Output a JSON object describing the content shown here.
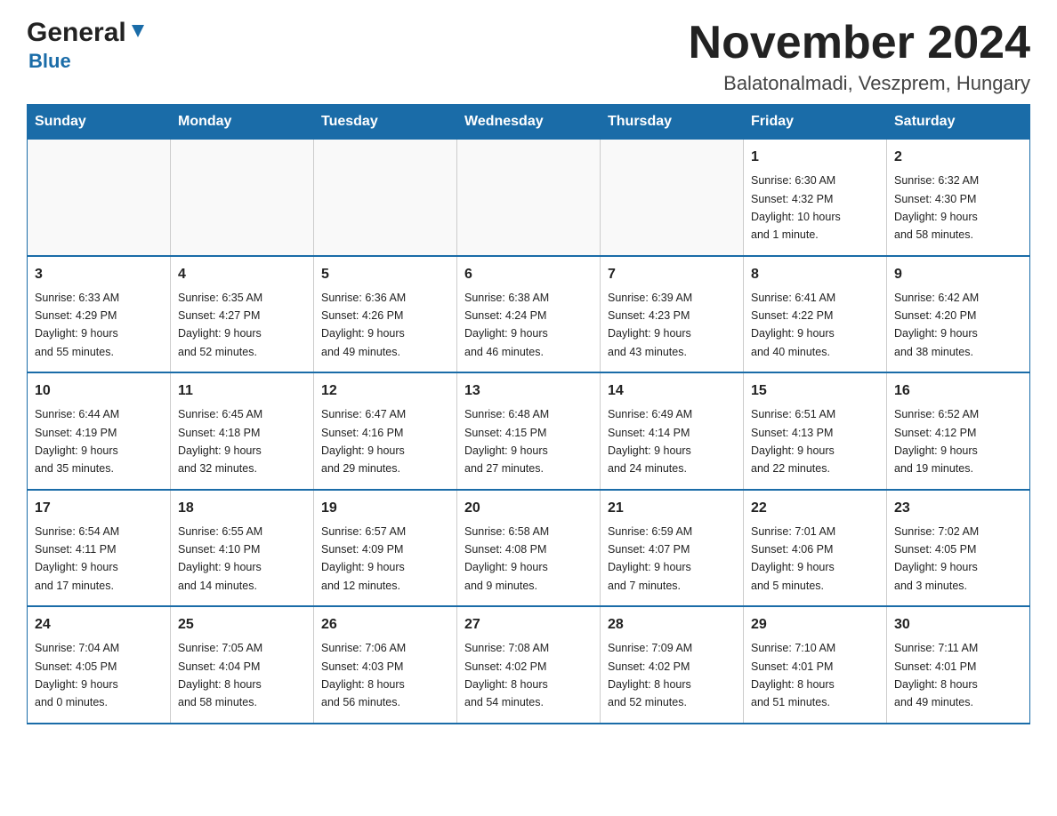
{
  "header": {
    "logo_general": "General",
    "logo_blue": "Blue",
    "title": "November 2024",
    "subtitle": "Balatonalmadi, Veszprem, Hungary"
  },
  "days_of_week": [
    "Sunday",
    "Monday",
    "Tuesday",
    "Wednesday",
    "Thursday",
    "Friday",
    "Saturday"
  ],
  "weeks": [
    [
      {
        "day": "",
        "info": ""
      },
      {
        "day": "",
        "info": ""
      },
      {
        "day": "",
        "info": ""
      },
      {
        "day": "",
        "info": ""
      },
      {
        "day": "",
        "info": ""
      },
      {
        "day": "1",
        "info": "Sunrise: 6:30 AM\nSunset: 4:32 PM\nDaylight: 10 hours\nand 1 minute."
      },
      {
        "day": "2",
        "info": "Sunrise: 6:32 AM\nSunset: 4:30 PM\nDaylight: 9 hours\nand 58 minutes."
      }
    ],
    [
      {
        "day": "3",
        "info": "Sunrise: 6:33 AM\nSunset: 4:29 PM\nDaylight: 9 hours\nand 55 minutes."
      },
      {
        "day": "4",
        "info": "Sunrise: 6:35 AM\nSunset: 4:27 PM\nDaylight: 9 hours\nand 52 minutes."
      },
      {
        "day": "5",
        "info": "Sunrise: 6:36 AM\nSunset: 4:26 PM\nDaylight: 9 hours\nand 49 minutes."
      },
      {
        "day": "6",
        "info": "Sunrise: 6:38 AM\nSunset: 4:24 PM\nDaylight: 9 hours\nand 46 minutes."
      },
      {
        "day": "7",
        "info": "Sunrise: 6:39 AM\nSunset: 4:23 PM\nDaylight: 9 hours\nand 43 minutes."
      },
      {
        "day": "8",
        "info": "Sunrise: 6:41 AM\nSunset: 4:22 PM\nDaylight: 9 hours\nand 40 minutes."
      },
      {
        "day": "9",
        "info": "Sunrise: 6:42 AM\nSunset: 4:20 PM\nDaylight: 9 hours\nand 38 minutes."
      }
    ],
    [
      {
        "day": "10",
        "info": "Sunrise: 6:44 AM\nSunset: 4:19 PM\nDaylight: 9 hours\nand 35 minutes."
      },
      {
        "day": "11",
        "info": "Sunrise: 6:45 AM\nSunset: 4:18 PM\nDaylight: 9 hours\nand 32 minutes."
      },
      {
        "day": "12",
        "info": "Sunrise: 6:47 AM\nSunset: 4:16 PM\nDaylight: 9 hours\nand 29 minutes."
      },
      {
        "day": "13",
        "info": "Sunrise: 6:48 AM\nSunset: 4:15 PM\nDaylight: 9 hours\nand 27 minutes."
      },
      {
        "day": "14",
        "info": "Sunrise: 6:49 AM\nSunset: 4:14 PM\nDaylight: 9 hours\nand 24 minutes."
      },
      {
        "day": "15",
        "info": "Sunrise: 6:51 AM\nSunset: 4:13 PM\nDaylight: 9 hours\nand 22 minutes."
      },
      {
        "day": "16",
        "info": "Sunrise: 6:52 AM\nSunset: 4:12 PM\nDaylight: 9 hours\nand 19 minutes."
      }
    ],
    [
      {
        "day": "17",
        "info": "Sunrise: 6:54 AM\nSunset: 4:11 PM\nDaylight: 9 hours\nand 17 minutes."
      },
      {
        "day": "18",
        "info": "Sunrise: 6:55 AM\nSunset: 4:10 PM\nDaylight: 9 hours\nand 14 minutes."
      },
      {
        "day": "19",
        "info": "Sunrise: 6:57 AM\nSunset: 4:09 PM\nDaylight: 9 hours\nand 12 minutes."
      },
      {
        "day": "20",
        "info": "Sunrise: 6:58 AM\nSunset: 4:08 PM\nDaylight: 9 hours\nand 9 minutes."
      },
      {
        "day": "21",
        "info": "Sunrise: 6:59 AM\nSunset: 4:07 PM\nDaylight: 9 hours\nand 7 minutes."
      },
      {
        "day": "22",
        "info": "Sunrise: 7:01 AM\nSunset: 4:06 PM\nDaylight: 9 hours\nand 5 minutes."
      },
      {
        "day": "23",
        "info": "Sunrise: 7:02 AM\nSunset: 4:05 PM\nDaylight: 9 hours\nand 3 minutes."
      }
    ],
    [
      {
        "day": "24",
        "info": "Sunrise: 7:04 AM\nSunset: 4:05 PM\nDaylight: 9 hours\nand 0 minutes."
      },
      {
        "day": "25",
        "info": "Sunrise: 7:05 AM\nSunset: 4:04 PM\nDaylight: 8 hours\nand 58 minutes."
      },
      {
        "day": "26",
        "info": "Sunrise: 7:06 AM\nSunset: 4:03 PM\nDaylight: 8 hours\nand 56 minutes."
      },
      {
        "day": "27",
        "info": "Sunrise: 7:08 AM\nSunset: 4:02 PM\nDaylight: 8 hours\nand 54 minutes."
      },
      {
        "day": "28",
        "info": "Sunrise: 7:09 AM\nSunset: 4:02 PM\nDaylight: 8 hours\nand 52 minutes."
      },
      {
        "day": "29",
        "info": "Sunrise: 7:10 AM\nSunset: 4:01 PM\nDaylight: 8 hours\nand 51 minutes."
      },
      {
        "day": "30",
        "info": "Sunrise: 7:11 AM\nSunset: 4:01 PM\nDaylight: 8 hours\nand 49 minutes."
      }
    ]
  ]
}
